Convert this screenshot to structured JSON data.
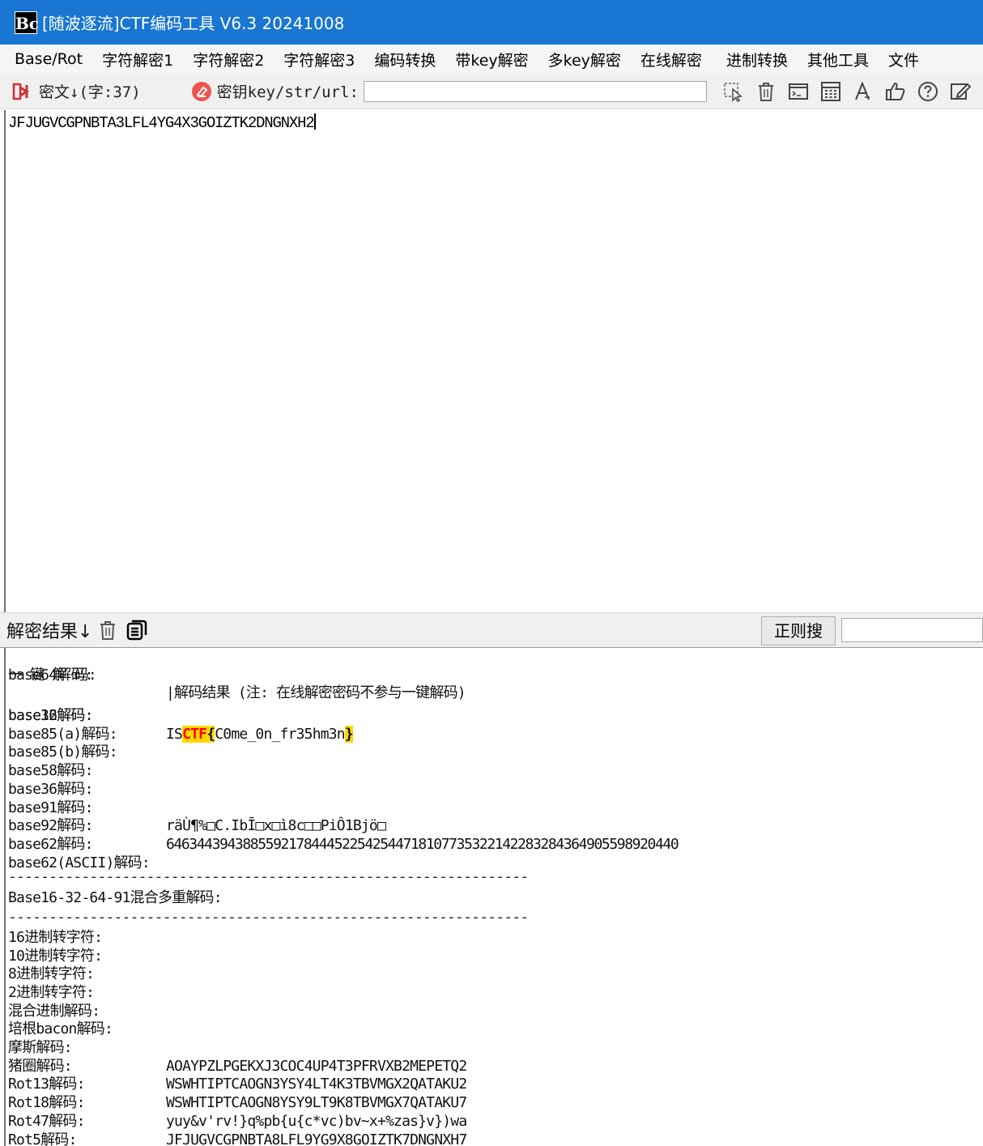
{
  "window": {
    "title": "[随波逐流]CTF编码工具 V6.3 20241008",
    "logo_text": "Bc"
  },
  "menu": [
    "Base/Rot",
    "字符解密1",
    "字符解密2",
    "字符解密3",
    "编码转换",
    "带key解密",
    "多key解密",
    "在线解密",
    "进制转换",
    "其他工具",
    "文件"
  ],
  "toolbar": {
    "cipher_label": "密文↓(字:37)",
    "key_label": "密钥key/str/url:",
    "key_value": "",
    "icons": [
      "select-icon",
      "trash-icon",
      "terminal-icon",
      "calculator-icon",
      "text-icon",
      "thumbs-up-icon",
      "help-icon",
      "edit-icon"
    ]
  },
  "cipher": {
    "text": "JFJUGVCGPNBTA3LFL4YG4X3GOIZTK2DNGNXH2"
  },
  "result_bar": {
    "title": "解密结果↓",
    "regex_button": "正则搜",
    "regex_value": ""
  },
  "results": {
    "header": {
      "label": "一 键 解 码:",
      "value": "|解码结果 (注: 在线解密密码不参与一键解码)"
    },
    "base64": {
      "label": "base64解码:",
      "value": ""
    },
    "base32": {
      "label": "base32解码:",
      "prefix": "IS",
      "flag": "CTF",
      "open_brace": "{",
      "body": "C0me_0n_fr35hm3n",
      "close_brace": "}"
    },
    "base16": {
      "label": "base16解码:",
      "value": ""
    },
    "base85a": {
      "label": "base85(a)解码:",
      "value": ""
    },
    "base85b": {
      "label": "base85(b)解码:",
      "value": ""
    },
    "base58": {
      "label": "base58解码:",
      "value": ""
    },
    "base36": {
      "label": "base36解码:",
      "value": ""
    },
    "base91": {
      "label": "base91解码:",
      "value": ""
    },
    "base92": {
      "label": "base92解码:",
      "value": "räÙ¶%□C.IbĪ□x□ì8c□□PiÔ1Bjö□"
    },
    "base62": {
      "label": "base62解码:",
      "value": "6463443943885592178444522542544718107735322142283284364905598920440"
    },
    "base62ascii": {
      "label": "base62(ASCII)解码:",
      "value": ""
    },
    "separator": "----------------------------------------------------------------",
    "mixed": {
      "label": "Base16-32-64-91混合多重解码:"
    },
    "hex16": {
      "label": "16进制转字符:"
    },
    "dec10": {
      "label": "10进制转字符:"
    },
    "oct8": {
      "label": "8进制转字符:"
    },
    "bin2": {
      "label": "2进制转字符:"
    },
    "mixbase": {
      "label": "混合进制解码:"
    },
    "bacon": {
      "label": "培根bacon解码:"
    },
    "morse": {
      "label": "摩斯解码:"
    },
    "pigpen": {
      "label": "猪圈解码:",
      "value": "AOAYPZLPGEKXJ3COC4UP4T3PFRVXB2MEPETQ2"
    },
    "rot13": {
      "label": "Rot13解码:",
      "value": "WSWHTIPTCAOGN3YSY4LT4K3TBVMGX2QATAKU2"
    },
    "rot18": {
      "label": "Rot18解码:",
      "value": "WSWHTIPTCAOGN8YSY9LT9K8TBVMGX7QATAKU7"
    },
    "rot47": {
      "label": "Rot47解码:",
      "value": "yuy&v'rv!}q%pb{u{c*vc)bv~x+%zas}v})wa"
    },
    "rot5": {
      "label": "Rot5解码:",
      "value": "JFJUGVCGPNBTA8LFL9YG9X8GOIZTK7DNGNXH7"
    }
  }
}
